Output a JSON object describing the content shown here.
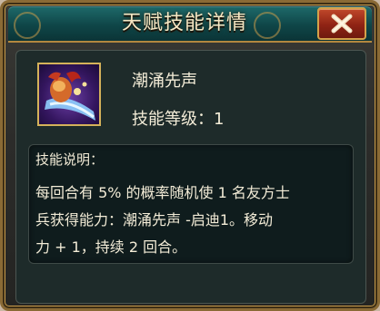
{
  "dialog": {
    "title": "天赋技能详情",
    "close_icon": "close-x-icon"
  },
  "skill": {
    "icon": "tidal-surge-skill-icon",
    "name": "潮涌先声",
    "level_text": "技能等级：1"
  },
  "description": {
    "heading": "技能说明：",
    "lines": [
      "每回合有 5% 的概率随机使 1 名友方士",
      "兵获得能力：潮涌先声 -启迪1。移动",
      "力 + 1，持续 2 回合。"
    ]
  },
  "colors": {
    "title_bar": "#0f4648",
    "frame_gold": "#c79b4b",
    "close_red": "#8f2314",
    "text": "#f3ecd7"
  }
}
